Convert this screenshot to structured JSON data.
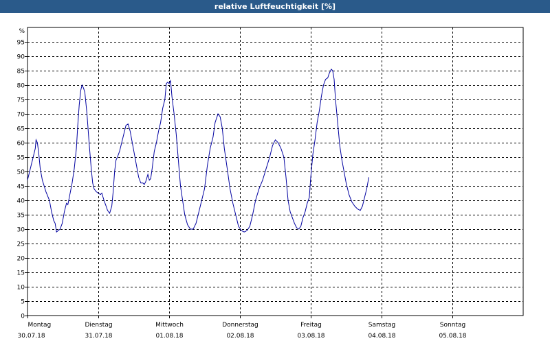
{
  "chart_data": {
    "type": "line",
    "title": "relative Luftfeuchtigkeit [%]",
    "unit": "%",
    "ylim": [
      0,
      100
    ],
    "yticks": [
      0,
      5,
      10,
      15,
      20,
      25,
      30,
      35,
      40,
      45,
      50,
      55,
      60,
      65,
      70,
      75,
      80,
      85,
      90,
      95
    ],
    "grid": true,
    "xlim": [
      0,
      7.0
    ],
    "day_labels": [
      {
        "weekday": "Montag",
        "date": "30.07.18"
      },
      {
        "weekday": "Dienstag",
        "date": "31.07.18"
      },
      {
        "weekday": "Mittwoch",
        "date": "01.08.18"
      },
      {
        "weekday": "Donnerstag",
        "date": "02.08.18"
      },
      {
        "weekday": "Freitag",
        "date": "03.08.18"
      },
      {
        "weekday": "Samstag",
        "date": "04.08.18"
      },
      {
        "weekday": "Sonntag",
        "date": "05.08.18"
      }
    ],
    "line_color": "#0000a0",
    "series": [
      {
        "points": [
          [
            0.0,
            47
          ],
          [
            0.03,
            50
          ],
          [
            0.06,
            53
          ],
          [
            0.09,
            56
          ],
          [
            0.11,
            58
          ],
          [
            0.12,
            61
          ],
          [
            0.14,
            60
          ],
          [
            0.16,
            56
          ],
          [
            0.18,
            51
          ],
          [
            0.21,
            47
          ],
          [
            0.26,
            43
          ],
          [
            0.31,
            40
          ],
          [
            0.34,
            36
          ],
          [
            0.37,
            33
          ],
          [
            0.39,
            32
          ],
          [
            0.41,
            29
          ],
          [
            0.46,
            30
          ],
          [
            0.49,
            32
          ],
          [
            0.52,
            36
          ],
          [
            0.55,
            39
          ],
          [
            0.57,
            38.5
          ],
          [
            0.59,
            41
          ],
          [
            0.63,
            46
          ],
          [
            0.66,
            51
          ],
          [
            0.69,
            58
          ],
          [
            0.71,
            66
          ],
          [
            0.73,
            73
          ],
          [
            0.75,
            78
          ],
          [
            0.77,
            80
          ],
          [
            0.79,
            79
          ],
          [
            0.81,
            77.5
          ],
          [
            0.84,
            70
          ],
          [
            0.87,
            60
          ],
          [
            0.9,
            51
          ],
          [
            0.92,
            46
          ],
          [
            0.94,
            44
          ],
          [
            0.97,
            43
          ],
          [
            1.0,
            42.5
          ],
          [
            1.03,
            42
          ],
          [
            1.05,
            42.5
          ],
          [
            1.08,
            40
          ],
          [
            1.11,
            38
          ],
          [
            1.13,
            36.5
          ],
          [
            1.16,
            35.5
          ],
          [
            1.19,
            38
          ],
          [
            1.21,
            43
          ],
          [
            1.23,
            50
          ],
          [
            1.25,
            54
          ],
          [
            1.27,
            55
          ],
          [
            1.3,
            57
          ],
          [
            1.33,
            60
          ],
          [
            1.36,
            63
          ],
          [
            1.39,
            66
          ],
          [
            1.42,
            66.5
          ],
          [
            1.45,
            64
          ],
          [
            1.48,
            60
          ],
          [
            1.51,
            56
          ],
          [
            1.54,
            52
          ],
          [
            1.57,
            48
          ],
          [
            1.6,
            46
          ],
          [
            1.63,
            46
          ],
          [
            1.65,
            45.5
          ],
          [
            1.67,
            46.5
          ],
          [
            1.7,
            49
          ],
          [
            1.72,
            47
          ],
          [
            1.74,
            47.5
          ],
          [
            1.76,
            51
          ],
          [
            1.79,
            57
          ],
          [
            1.82,
            60
          ],
          [
            1.85,
            64
          ],
          [
            1.88,
            67
          ],
          [
            1.91,
            72
          ],
          [
            1.94,
            75
          ],
          [
            1.96,
            80.5
          ],
          [
            1.98,
            81
          ],
          [
            2.0,
            80.5
          ],
          [
            2.02,
            81.5
          ],
          [
            2.04,
            76
          ],
          [
            2.07,
            70
          ],
          [
            2.1,
            63
          ],
          [
            2.13,
            54
          ],
          [
            2.16,
            45
          ],
          [
            2.19,
            40
          ],
          [
            2.22,
            35
          ],
          [
            2.26,
            31.5
          ],
          [
            2.3,
            30
          ],
          [
            2.34,
            30
          ],
          [
            2.38,
            32
          ],
          [
            2.42,
            36
          ],
          [
            2.46,
            40
          ],
          [
            2.5,
            44
          ],
          [
            2.54,
            52
          ],
          [
            2.58,
            58
          ],
          [
            2.62,
            62
          ],
          [
            2.65,
            67
          ],
          [
            2.69,
            70
          ],
          [
            2.72,
            69
          ],
          [
            2.75,
            65
          ],
          [
            2.78,
            58
          ],
          [
            2.82,
            51
          ],
          [
            2.86,
            44
          ],
          [
            2.9,
            39
          ],
          [
            2.94,
            35
          ],
          [
            2.98,
            31
          ],
          [
            3.02,
            29.5
          ],
          [
            3.06,
            29
          ],
          [
            3.1,
            29.5
          ],
          [
            3.14,
            31
          ],
          [
            3.18,
            35
          ],
          [
            3.22,
            40
          ],
          [
            3.27,
            44
          ],
          [
            3.32,
            47
          ],
          [
            3.37,
            51
          ],
          [
            3.42,
            55
          ],
          [
            3.46,
            59
          ],
          [
            3.5,
            61
          ],
          [
            3.54,
            60
          ],
          [
            3.58,
            58
          ],
          [
            3.62,
            55
          ],
          [
            3.65,
            48
          ],
          [
            3.68,
            40
          ],
          [
            3.71,
            36
          ],
          [
            3.74,
            34
          ],
          [
            3.77,
            32
          ],
          [
            3.8,
            30.5
          ],
          [
            3.83,
            30
          ],
          [
            3.86,
            31
          ],
          [
            3.89,
            34
          ],
          [
            3.92,
            36
          ],
          [
            3.95,
            39
          ],
          [
            3.98,
            41
          ],
          [
            4.0,
            48
          ],
          [
            4.03,
            56
          ],
          [
            4.06,
            61
          ],
          [
            4.09,
            67
          ],
          [
            4.12,
            71
          ],
          [
            4.15,
            76
          ],
          [
            4.18,
            80
          ],
          [
            4.21,
            82
          ],
          [
            4.24,
            82.5
          ],
          [
            4.26,
            84
          ],
          [
            4.29,
            85.5
          ],
          [
            4.31,
            85
          ],
          [
            4.33,
            82
          ],
          [
            4.35,
            75
          ],
          [
            4.38,
            67
          ],
          [
            4.41,
            59
          ],
          [
            4.44,
            54
          ],
          [
            4.47,
            50
          ],
          [
            4.5,
            46
          ],
          [
            4.54,
            42
          ],
          [
            4.58,
            39.5
          ],
          [
            4.62,
            38
          ],
          [
            4.66,
            37
          ],
          [
            4.7,
            36.5
          ],
          [
            4.73,
            38
          ],
          [
            4.76,
            41
          ],
          [
            4.79,
            44
          ],
          [
            4.82,
            48
          ]
        ]
      }
    ]
  }
}
